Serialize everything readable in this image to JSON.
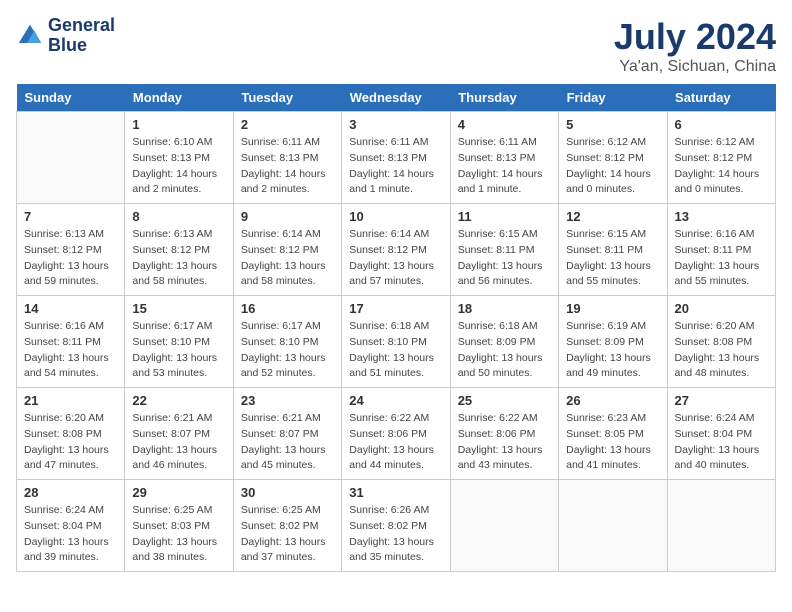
{
  "header": {
    "logo_line1": "General",
    "logo_line2": "Blue",
    "month": "July 2024",
    "location": "Ya'an, Sichuan, China"
  },
  "weekdays": [
    "Sunday",
    "Monday",
    "Tuesday",
    "Wednesday",
    "Thursday",
    "Friday",
    "Saturday"
  ],
  "weeks": [
    [
      {
        "day": "",
        "sunrise": "",
        "sunset": "",
        "daylight": "",
        "empty": true
      },
      {
        "day": "1",
        "sunrise": "Sunrise: 6:10 AM",
        "sunset": "Sunset: 8:13 PM",
        "daylight": "Daylight: 14 hours and 2 minutes."
      },
      {
        "day": "2",
        "sunrise": "Sunrise: 6:11 AM",
        "sunset": "Sunset: 8:13 PM",
        "daylight": "Daylight: 14 hours and 2 minutes."
      },
      {
        "day": "3",
        "sunrise": "Sunrise: 6:11 AM",
        "sunset": "Sunset: 8:13 PM",
        "daylight": "Daylight: 14 hours and 1 minute."
      },
      {
        "day": "4",
        "sunrise": "Sunrise: 6:11 AM",
        "sunset": "Sunset: 8:13 PM",
        "daylight": "Daylight: 14 hours and 1 minute."
      },
      {
        "day": "5",
        "sunrise": "Sunrise: 6:12 AM",
        "sunset": "Sunset: 8:12 PM",
        "daylight": "Daylight: 14 hours and 0 minutes."
      },
      {
        "day": "6",
        "sunrise": "Sunrise: 6:12 AM",
        "sunset": "Sunset: 8:12 PM",
        "daylight": "Daylight: 14 hours and 0 minutes."
      }
    ],
    [
      {
        "day": "7",
        "sunrise": "Sunrise: 6:13 AM",
        "sunset": "Sunset: 8:12 PM",
        "daylight": "Daylight: 13 hours and 59 minutes."
      },
      {
        "day": "8",
        "sunrise": "Sunrise: 6:13 AM",
        "sunset": "Sunset: 8:12 PM",
        "daylight": "Daylight: 13 hours and 58 minutes."
      },
      {
        "day": "9",
        "sunrise": "Sunrise: 6:14 AM",
        "sunset": "Sunset: 8:12 PM",
        "daylight": "Daylight: 13 hours and 58 minutes."
      },
      {
        "day": "10",
        "sunrise": "Sunrise: 6:14 AM",
        "sunset": "Sunset: 8:12 PM",
        "daylight": "Daylight: 13 hours and 57 minutes."
      },
      {
        "day": "11",
        "sunrise": "Sunrise: 6:15 AM",
        "sunset": "Sunset: 8:11 PM",
        "daylight": "Daylight: 13 hours and 56 minutes."
      },
      {
        "day": "12",
        "sunrise": "Sunrise: 6:15 AM",
        "sunset": "Sunset: 8:11 PM",
        "daylight": "Daylight: 13 hours and 55 minutes."
      },
      {
        "day": "13",
        "sunrise": "Sunrise: 6:16 AM",
        "sunset": "Sunset: 8:11 PM",
        "daylight": "Daylight: 13 hours and 55 minutes."
      }
    ],
    [
      {
        "day": "14",
        "sunrise": "Sunrise: 6:16 AM",
        "sunset": "Sunset: 8:11 PM",
        "daylight": "Daylight: 13 hours and 54 minutes."
      },
      {
        "day": "15",
        "sunrise": "Sunrise: 6:17 AM",
        "sunset": "Sunset: 8:10 PM",
        "daylight": "Daylight: 13 hours and 53 minutes."
      },
      {
        "day": "16",
        "sunrise": "Sunrise: 6:17 AM",
        "sunset": "Sunset: 8:10 PM",
        "daylight": "Daylight: 13 hours and 52 minutes."
      },
      {
        "day": "17",
        "sunrise": "Sunrise: 6:18 AM",
        "sunset": "Sunset: 8:10 PM",
        "daylight": "Daylight: 13 hours and 51 minutes."
      },
      {
        "day": "18",
        "sunrise": "Sunrise: 6:18 AM",
        "sunset": "Sunset: 8:09 PM",
        "daylight": "Daylight: 13 hours and 50 minutes."
      },
      {
        "day": "19",
        "sunrise": "Sunrise: 6:19 AM",
        "sunset": "Sunset: 8:09 PM",
        "daylight": "Daylight: 13 hours and 49 minutes."
      },
      {
        "day": "20",
        "sunrise": "Sunrise: 6:20 AM",
        "sunset": "Sunset: 8:08 PM",
        "daylight": "Daylight: 13 hours and 48 minutes."
      }
    ],
    [
      {
        "day": "21",
        "sunrise": "Sunrise: 6:20 AM",
        "sunset": "Sunset: 8:08 PM",
        "daylight": "Daylight: 13 hours and 47 minutes."
      },
      {
        "day": "22",
        "sunrise": "Sunrise: 6:21 AM",
        "sunset": "Sunset: 8:07 PM",
        "daylight": "Daylight: 13 hours and 46 minutes."
      },
      {
        "day": "23",
        "sunrise": "Sunrise: 6:21 AM",
        "sunset": "Sunset: 8:07 PM",
        "daylight": "Daylight: 13 hours and 45 minutes."
      },
      {
        "day": "24",
        "sunrise": "Sunrise: 6:22 AM",
        "sunset": "Sunset: 8:06 PM",
        "daylight": "Daylight: 13 hours and 44 minutes."
      },
      {
        "day": "25",
        "sunrise": "Sunrise: 6:22 AM",
        "sunset": "Sunset: 8:06 PM",
        "daylight": "Daylight: 13 hours and 43 minutes."
      },
      {
        "day": "26",
        "sunrise": "Sunrise: 6:23 AM",
        "sunset": "Sunset: 8:05 PM",
        "daylight": "Daylight: 13 hours and 41 minutes."
      },
      {
        "day": "27",
        "sunrise": "Sunrise: 6:24 AM",
        "sunset": "Sunset: 8:04 PM",
        "daylight": "Daylight: 13 hours and 40 minutes."
      }
    ],
    [
      {
        "day": "28",
        "sunrise": "Sunrise: 6:24 AM",
        "sunset": "Sunset: 8:04 PM",
        "daylight": "Daylight: 13 hours and 39 minutes."
      },
      {
        "day": "29",
        "sunrise": "Sunrise: 6:25 AM",
        "sunset": "Sunset: 8:03 PM",
        "daylight": "Daylight: 13 hours and 38 minutes."
      },
      {
        "day": "30",
        "sunrise": "Sunrise: 6:25 AM",
        "sunset": "Sunset: 8:02 PM",
        "daylight": "Daylight: 13 hours and 37 minutes."
      },
      {
        "day": "31",
        "sunrise": "Sunrise: 6:26 AM",
        "sunset": "Sunset: 8:02 PM",
        "daylight": "Daylight: 13 hours and 35 minutes."
      },
      {
        "day": "",
        "sunrise": "",
        "sunset": "",
        "daylight": "",
        "empty": true
      },
      {
        "day": "",
        "sunrise": "",
        "sunset": "",
        "daylight": "",
        "empty": true
      },
      {
        "day": "",
        "sunrise": "",
        "sunset": "",
        "daylight": "",
        "empty": true
      }
    ]
  ]
}
